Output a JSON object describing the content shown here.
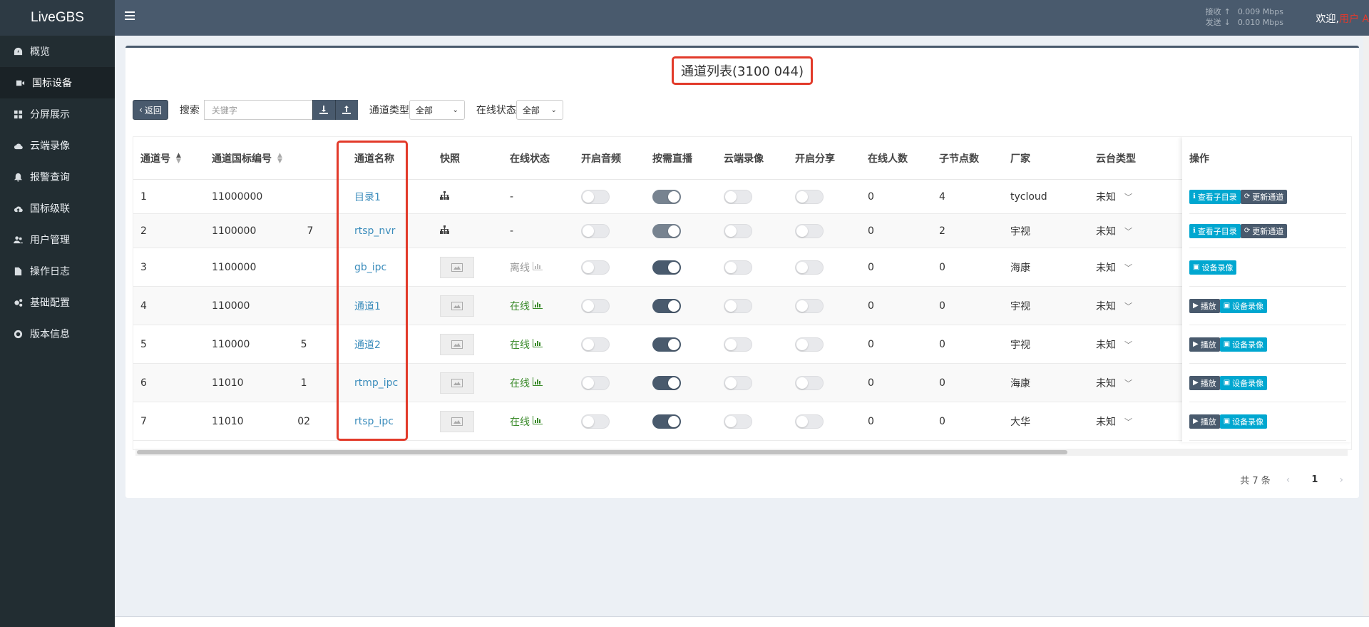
{
  "app": {
    "logo": "LiveGBS"
  },
  "sidebar": {
    "items": [
      {
        "label": "概览",
        "icon": "dashboard-icon"
      },
      {
        "label": "国标设备",
        "icon": "video-camera-icon",
        "active": true
      },
      {
        "label": "分屏展示",
        "icon": "grid-icon"
      },
      {
        "label": "云端录像",
        "icon": "cloud-icon"
      },
      {
        "label": "报警查询",
        "icon": "bell-icon"
      },
      {
        "label": "国标级联",
        "icon": "cloud-upload-icon"
      },
      {
        "label": "用户管理",
        "icon": "users-icon"
      },
      {
        "label": "操作日志",
        "icon": "file-icon"
      },
      {
        "label": "基础配置",
        "icon": "gears-icon"
      },
      {
        "label": "版本信息",
        "icon": "life-ring-icon"
      }
    ]
  },
  "header": {
    "recv_label": "接收",
    "recv_value": "0.009 Mbps",
    "send_label": "发送",
    "send_value": "0.010 Mbps",
    "welcome": "欢迎,",
    "username": "用户 A"
  },
  "page": {
    "title": "通道列表(3100                    044)"
  },
  "toolbar": {
    "back_label": "返回",
    "search_label": "搜索",
    "search_placeholder": "关键字",
    "channel_type_label": "通道类型",
    "channel_type_value": "全部",
    "online_status_label": "在线状态",
    "online_status_value": "全部"
  },
  "table": {
    "headers": [
      "通道号",
      "通道国标编号",
      "通道名称",
      "快照",
      "在线状态",
      "开启音频",
      "按需直播",
      "云端录像",
      "开启分享",
      "在线人数",
      "子节点数",
      "厂家",
      "云台类型",
      "操作"
    ],
    "rows": [
      {
        "no": "1",
        "code": "11000000",
        "name": "目录1",
        "snapshot": "tree",
        "status": "-",
        "audio": false,
        "ondemand": "mid",
        "cloud": false,
        "share": false,
        "viewers": "0",
        "children": "4",
        "vendor": "tycloud",
        "ptz": "未知",
        "actions": [
          {
            "label": "查看子目录",
            "style": "cyan",
            "icon": "info-icon"
          },
          {
            "label": "更新通道",
            "style": "dark",
            "icon": "refresh-icon"
          }
        ]
      },
      {
        "no": "2",
        "code": "1100000                7",
        "name": "rtsp_nvr",
        "snapshot": "tree",
        "status": "-",
        "audio": false,
        "ondemand": "mid",
        "cloud": false,
        "share": false,
        "viewers": "0",
        "children": "2",
        "vendor": "宇视",
        "ptz": "未知",
        "actions": [
          {
            "label": "查看子目录",
            "style": "cyan",
            "icon": "info-icon"
          },
          {
            "label": "更新通道",
            "style": "dark",
            "icon": "refresh-icon"
          }
        ]
      },
      {
        "no": "3",
        "code": "1100000",
        "name": "gb_ipc",
        "snapshot": "image",
        "status": "离线",
        "statusClass": "muted",
        "audio": false,
        "ondemand": "on",
        "cloud": false,
        "share": false,
        "viewers": "0",
        "children": "0",
        "vendor": "海康",
        "ptz": "未知",
        "actions": [
          {
            "label": "设备录像",
            "style": "cyan",
            "icon": "file-video-icon"
          }
        ]
      },
      {
        "no": "4",
        "code": "110000",
        "name": "通道1",
        "snapshot": "image",
        "status": "在线",
        "statusClass": "green",
        "audio": false,
        "ondemand": "on",
        "cloud": false,
        "share": false,
        "viewers": "0",
        "children": "0",
        "vendor": "宇视",
        "ptz": "未知",
        "actions": [
          {
            "label": "播放",
            "style": "dark",
            "icon": "play-icon"
          },
          {
            "label": "设备录像",
            "style": "cyan",
            "icon": "file-video-icon"
          }
        ]
      },
      {
        "no": "5",
        "code": "110000                5",
        "name": "通道2",
        "snapshot": "image",
        "status": "在线",
        "statusClass": "green",
        "audio": false,
        "ondemand": "on",
        "cloud": false,
        "share": false,
        "viewers": "0",
        "children": "0",
        "vendor": "宇视",
        "ptz": "未知",
        "actions": [
          {
            "label": "播放",
            "style": "dark",
            "icon": "play-icon"
          },
          {
            "label": "设备录像",
            "style": "cyan",
            "icon": "file-video-icon"
          }
        ]
      },
      {
        "no": "6",
        "code": "11010                  1",
        "name": "rtmp_ipc",
        "snapshot": "image",
        "status": "在线",
        "statusClass": "green",
        "audio": false,
        "ondemand": "on",
        "cloud": false,
        "share": false,
        "viewers": "0",
        "children": "0",
        "vendor": "海康",
        "ptz": "未知",
        "actions": [
          {
            "label": "播放",
            "style": "dark",
            "icon": "play-icon"
          },
          {
            "label": "设备录像",
            "style": "cyan",
            "icon": "file-video-icon"
          }
        ]
      },
      {
        "no": "7",
        "code": "11010                 02",
        "name": "rtsp_ipc",
        "snapshot": "image",
        "status": "在线",
        "statusClass": "green",
        "audio": false,
        "ondemand": "on",
        "cloud": false,
        "share": false,
        "viewers": "0",
        "children": "0",
        "vendor": "大华",
        "ptz": "未知",
        "actions": [
          {
            "label": "播放",
            "style": "dark",
            "icon": "play-icon"
          },
          {
            "label": "设备录像",
            "style": "cyan",
            "icon": "file-video-icon"
          }
        ]
      }
    ]
  },
  "pagination": {
    "total": "共 7 条",
    "current": "1"
  }
}
